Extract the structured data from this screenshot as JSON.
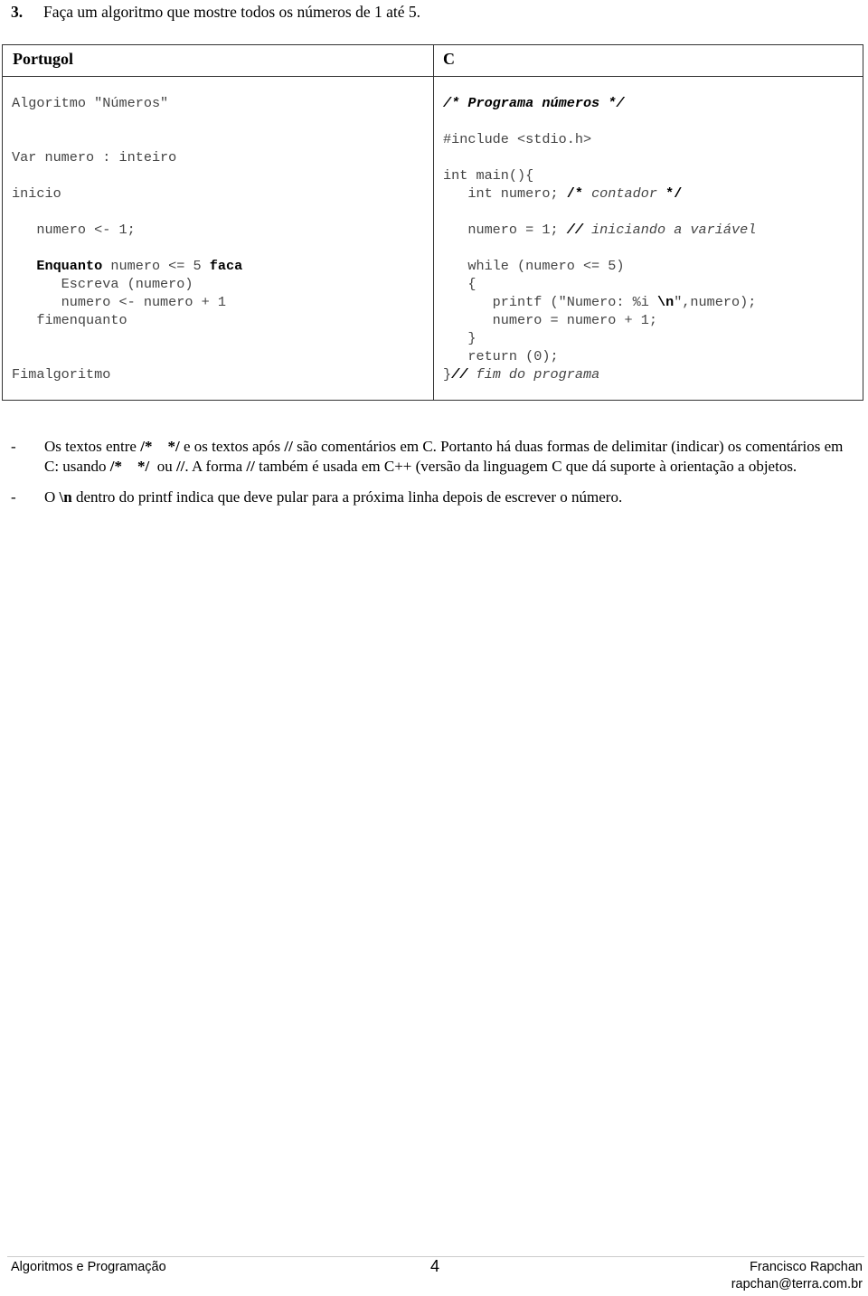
{
  "question": {
    "number": "3.",
    "text": "Faça um algoritmo que mostre todos os números de 1 até 5."
  },
  "table": {
    "headers": [
      "Portugol",
      "C"
    ],
    "portugol": {
      "l1": "Algoritmo \"Números\"",
      "l2": "Var numero : inteiro",
      "l3": "inicio",
      "l4": "   numero <- 1;",
      "l5_kw1": "Enquanto",
      "l5_mid": " numero <= 5 ",
      "l5_kw2": "faca",
      "l6": "      Escreva (numero)",
      "l7": "      numero <- numero + 1",
      "l8": "   fimenquanto",
      "l9": "Fimalgoritmo"
    },
    "c": {
      "l1": "/* Programa números */",
      "l2": "#include <stdio.h>",
      "l3": "int main(){",
      "l4_code": "   int numero; ",
      "l4_open": "/*",
      "l4_comment": " contador ",
      "l4_close": "*/",
      "l5_code": "   numero = 1; ",
      "l5_slashes": "//",
      "l5_comment": " iniciando a variável",
      "l6": "   while (numero <= 5)",
      "l7": "   {",
      "l8_a": "      printf (\"Numero: %i ",
      "l8_b": "\\n",
      "l8_c": "\",numero);",
      "l9": "      numero = numero + 1;",
      "l10": "   }",
      "l11": "   return (0);",
      "l12_brace": "}",
      "l12_slashes": "//",
      "l12_comment": " fim do programa"
    }
  },
  "notes": [
    {
      "dash": "-",
      "parts": [
        "Os textos entre ",
        "/*    */",
        " e os textos após ",
        "//",
        " são comentários em C. Portanto há duas formas de delimitar (indicar) os comentários em C: usando ",
        "/*    */",
        "  ou ",
        "//",
        ". A forma ",
        "//",
        " também é usada em C++ (versão da linguagem C que dá suporte à orientação a objetos."
      ]
    },
    {
      "dash": "-",
      "parts": [
        "O ",
        "\\n",
        " dentro do printf indica que deve pular para a próxima linha depois de escrever o número."
      ]
    }
  ],
  "footer": {
    "course": "Algoritmos e Programação",
    "page": "4",
    "author": "Francisco Rapchan",
    "email": "rapchan@terra.com.br"
  }
}
